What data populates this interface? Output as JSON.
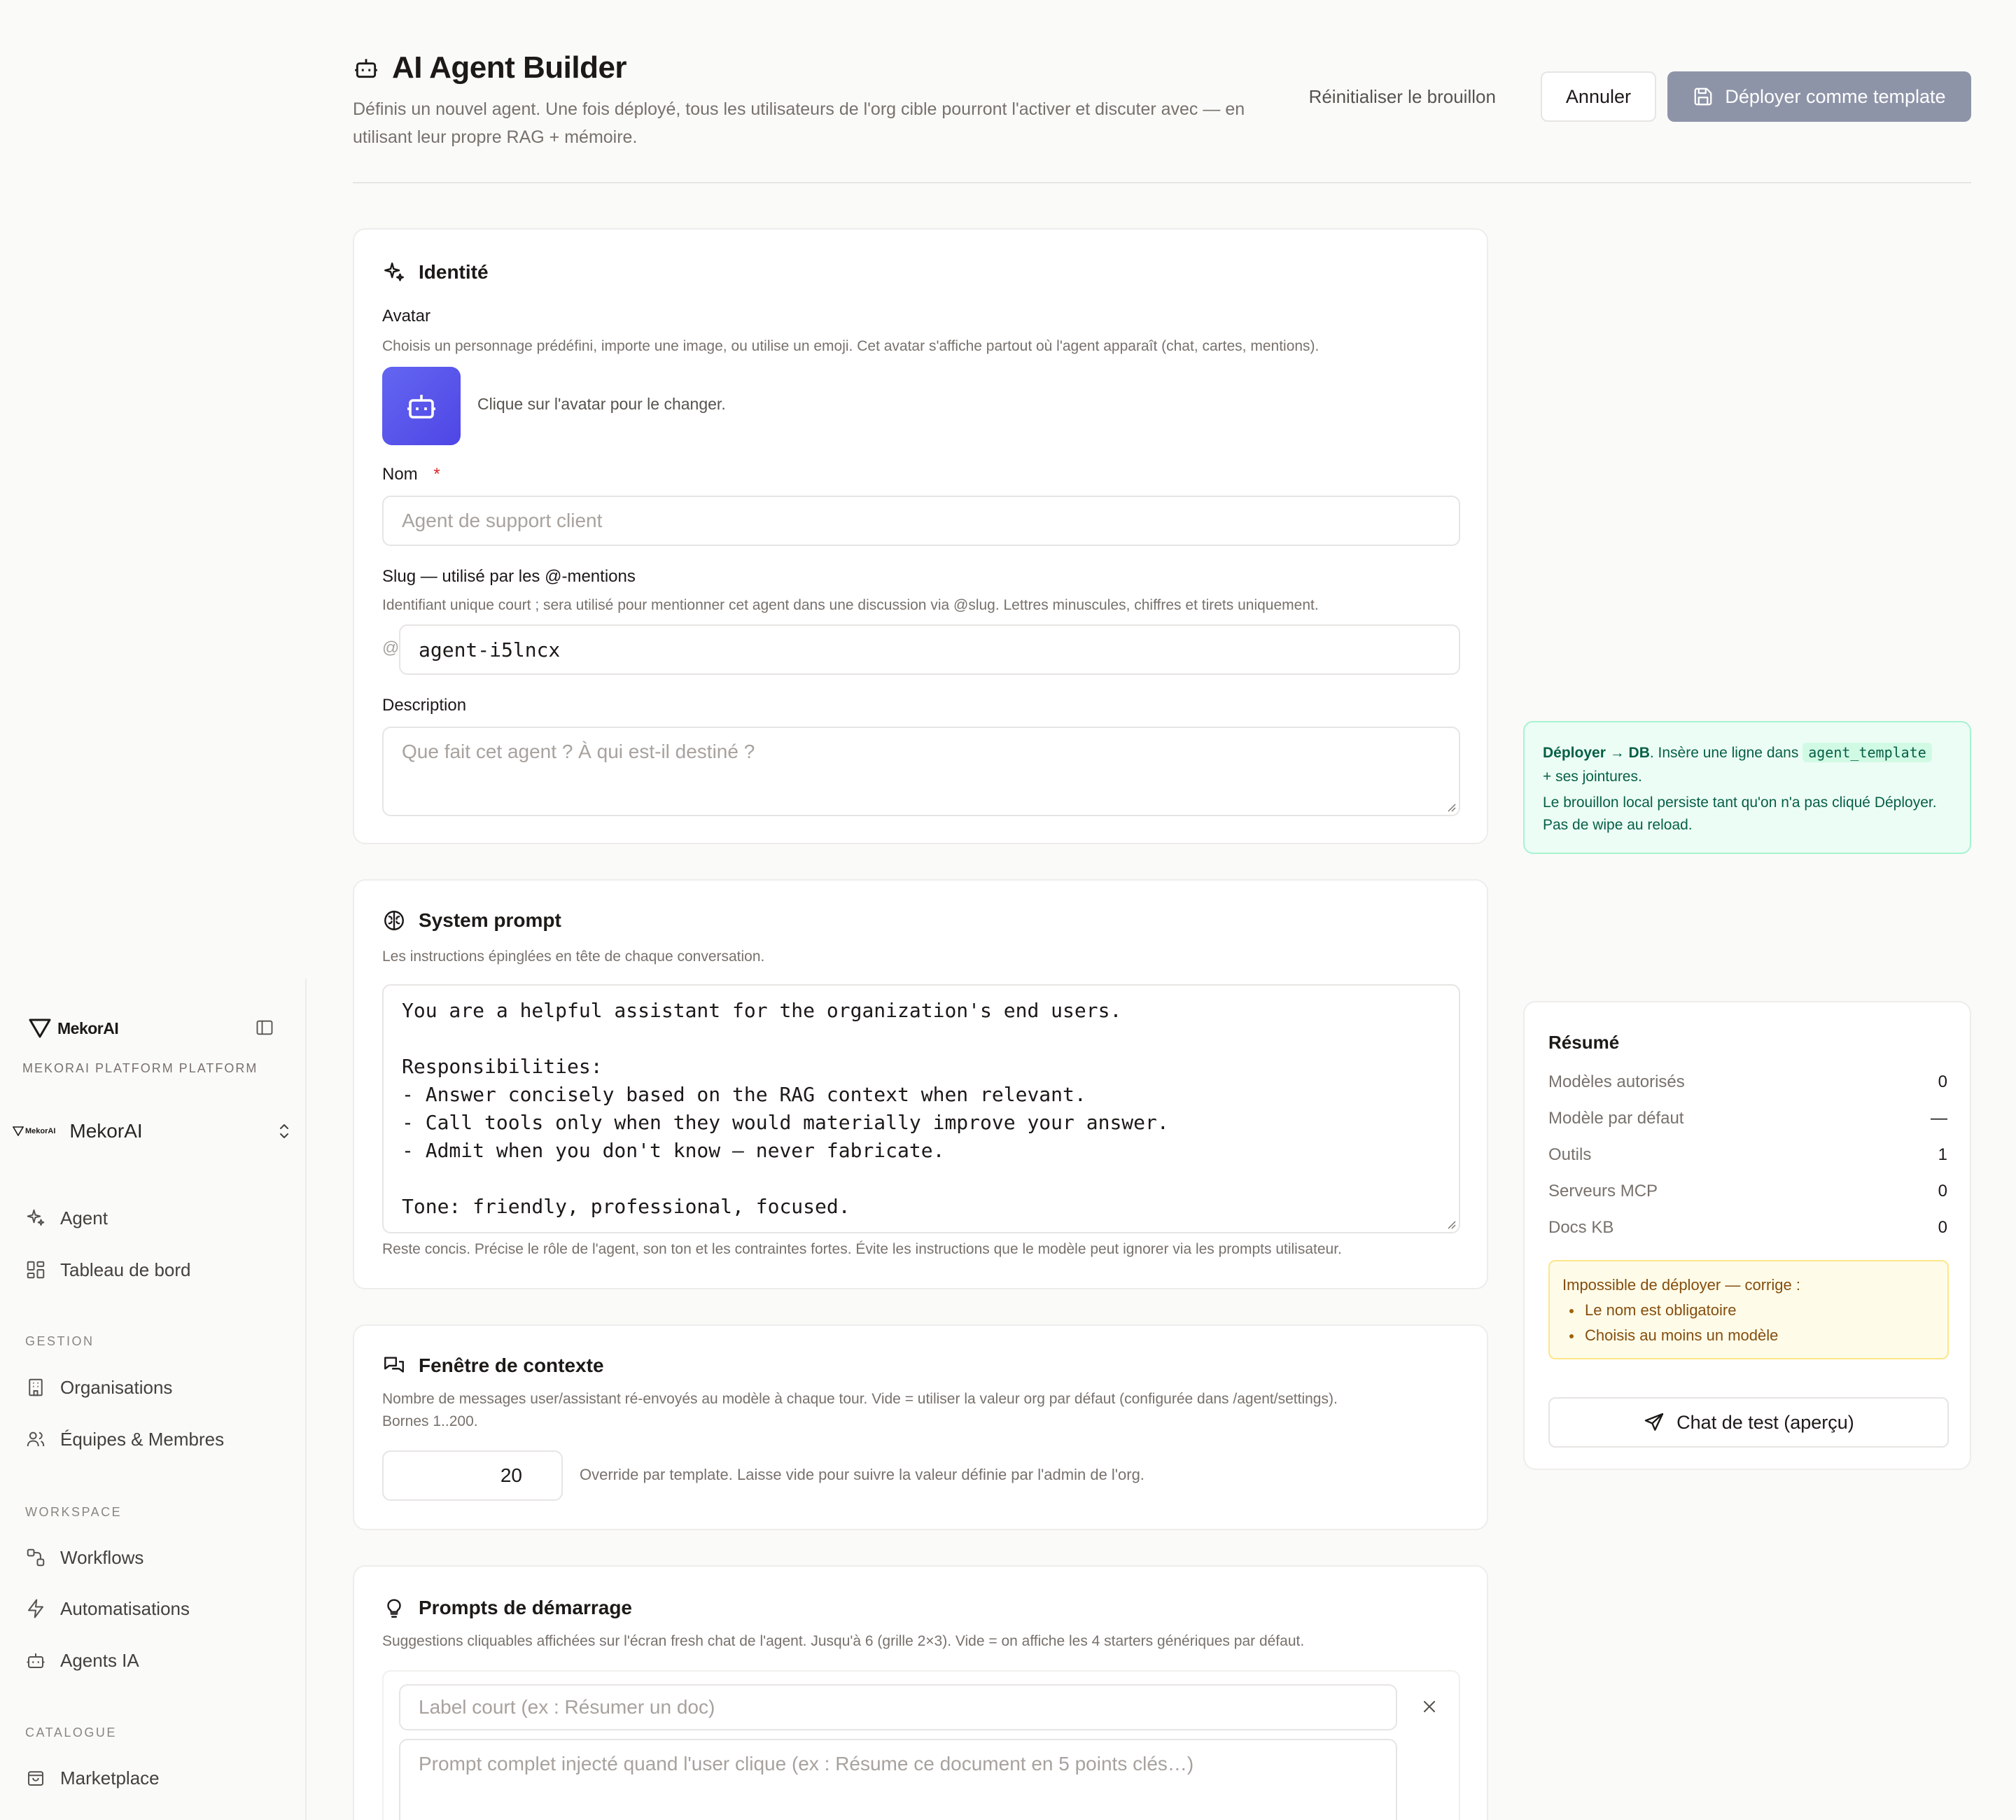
{
  "header": {
    "title": "AI Agent Builder",
    "subtitle": "Définis un nouvel agent. Une fois déployé, tous les utilisateurs de l'org cible pourront l'activer et discuter avec — en utilisant leur propre RAG + mémoire.",
    "reset_label": "Réinitialiser le brouillon",
    "cancel_label": "Annuler",
    "deploy_label": "Déployer comme template"
  },
  "sidebar": {
    "brand": "MekorAI",
    "platform_label": "MEKORAI PLATFORM PLATFORM",
    "org_logo_text": "MekorAI",
    "org_name": "MekorAI",
    "items": [
      {
        "label": "Agent",
        "icon": "sparkles-icon"
      },
      {
        "label": "Tableau de bord",
        "icon": "dashboard-icon"
      }
    ],
    "sections": [
      {
        "title": "GESTION",
        "items": [
          {
            "label": "Organisations",
            "icon": "building-icon"
          },
          {
            "label": "Équipes & Membres",
            "icon": "users-icon"
          }
        ]
      },
      {
        "title": "WORKSPACE",
        "items": [
          {
            "label": "Workflows",
            "icon": "workflow-icon"
          },
          {
            "label": "Automatisations",
            "icon": "zap-icon"
          },
          {
            "label": "Agents IA",
            "icon": "bot-icon"
          }
        ]
      },
      {
        "title": "CATALOGUE",
        "items": [
          {
            "label": "Marketplace",
            "icon": "store-icon"
          }
        ]
      }
    ]
  },
  "identity": {
    "title": "Identité",
    "avatar_label": "Avatar",
    "avatar_help": "Choisis un personnage prédéfini, importe une image, ou utilise un emoji. Cet avatar s'affiche partout où l'agent apparaît (chat, cartes, mentions).",
    "avatar_hint": "Clique sur l'avatar pour le changer.",
    "name_label": "Nom",
    "required_mark": "*",
    "name_placeholder": "Agent de support client",
    "slug_label": "Slug — utilisé par les @-mentions",
    "slug_help": "Identifiant unique court ; sera utilisé pour mentionner cet agent dans une discussion via @slug. Lettres minuscules, chiffres et tirets uniquement.",
    "slug_prefix": "@",
    "slug_value": "agent-i5lncx",
    "description_label": "Description",
    "description_placeholder": "Que fait cet agent ? À qui est-il destiné ?"
  },
  "system_prompt": {
    "title": "System prompt",
    "help": "Les instructions épinglées en tête de chaque conversation.",
    "lines": [
      "You are a helpful assistant for the organization's end users.",
      "",
      "Responsibilities:",
      "- Answer concisely based on the RAG context when relevant.",
      "- Call tools only when they would materially improve your answer.",
      "- Admit when you don't know — never fabricate.",
      "",
      "Tone: friendly, professional, focused."
    ],
    "footer": "Reste concis. Précise le rôle de l'agent, son ton et les contraintes fortes. Évite les instructions que le modèle peut ignorer via les prompts utilisateur."
  },
  "context_window": {
    "title": "Fenêtre de contexte",
    "help_line1": "Nombre de messages user/assistant ré-envoyés au modèle à chaque tour. Vide = utiliser la valeur org par défaut (configurée dans /agent/settings).",
    "help_line2": "Bornes 1..200.",
    "value": "20",
    "note": "Override par template. Laisse vide pour suivre la valeur définie par l'admin de l'org."
  },
  "starters": {
    "title": "Prompts de démarrage",
    "help": "Suggestions cliquables affichées sur l'écran fresh chat de l'agent. Jusqu'à 6 (grille 2×3). Vide = on affiche les 4 starters génériques par défaut.",
    "label_placeholder": "Label court (ex : Résumer un doc)",
    "prompt_placeholder": "Prompt complet injecté quand l'user clique (ex : Résume ce document en 5 points clés…)"
  },
  "deploy_note": {
    "strong": "Déployer → DB",
    "text1": ". Insère une ligne dans ",
    "code": "agent_template",
    "text2": "+ ses jointures.",
    "text3": "Le brouillon local persiste tant qu'on n'a pas cliqué Déployer. Pas de wipe au reload."
  },
  "summary": {
    "title": "Résumé",
    "rows": [
      {
        "label": "Modèles autorisés",
        "value": "0"
      },
      {
        "label": "Modèle par défaut",
        "value": "—"
      },
      {
        "label": "Outils",
        "value": "1"
      },
      {
        "label": "Serveurs MCP",
        "value": "0"
      },
      {
        "label": "Docs KB",
        "value": "0"
      }
    ],
    "warning_title": "Impossible de déployer — corrige :",
    "warnings": [
      "Le nom est obligatoire",
      "Choisis au moins un modèle"
    ],
    "chat_label": "Chat de test (aperçu)"
  },
  "colors": {
    "accent": "#6366f1",
    "primary_disabled": "#8e94a8",
    "success_bg": "#ecfdf5",
    "warning_bg": "#fefce8",
    "required": "#dc2626"
  }
}
